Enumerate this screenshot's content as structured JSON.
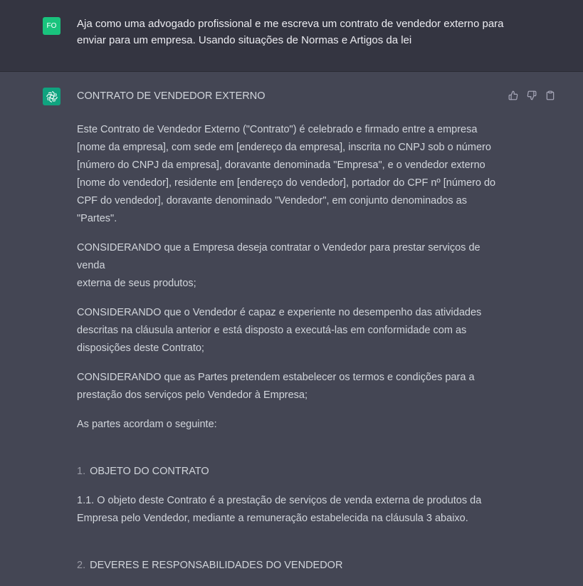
{
  "user": {
    "avatar_initials": "FO",
    "message": "Aja como uma advogado profissional e me escreva um contrato de vendedor externo para\nenviar para um empresa. Usando situações de Normas e Artigos da lei"
  },
  "assistant": {
    "icon": "openai-logo-icon",
    "actions": [
      "thumbs-up-icon",
      "thumbs-down-icon",
      "copy-icon"
    ],
    "title": "CONTRATO DE VENDEDOR EXTERNO",
    "paragraphs": [
      "Este Contrato de Vendedor Externo (\"Contrato\") é celebrado e firmado entre a empresa\n[nome da empresa], com sede em [endereço da empresa], inscrita no CNPJ sob o número\n[número do CNPJ da empresa], doravante denominada \"Empresa\", e o vendedor externo\n[nome do vendedor], residente em [endereço do vendedor], portador do CPF nº [número do\nCPF do vendedor], doravante denominado \"Vendedor\", em conjunto denominados as\n\"Partes\".",
      "CONSIDERANDO que a Empresa deseja contratar o Vendedor para prestar serviços de venda\nexterna de seus produtos;",
      "CONSIDERANDO que o Vendedor é capaz e experiente no desempenho das atividades\ndescritas na cláusula anterior e está disposto a executá-las em conformidade com as\ndisposições deste Contrato;",
      "CONSIDERANDO que as Partes pretendem estabelecer os termos e condições para a\nprestação dos serviços pelo Vendedor à Empresa;",
      "As partes acordam o seguinte:"
    ],
    "section1": {
      "number": "1.",
      "title": "OBJETO DO CONTRATO"
    },
    "clause_1_1": "1.1. O objeto deste Contrato é a prestação de serviços de venda externa de produtos da\nEmpresa pelo Vendedor, mediante a remuneração estabelecida na cláusula 3 abaixo.",
    "section2": {
      "number": "2.",
      "title": "DEVERES E RESPONSABILIDADES DO VENDEDOR"
    }
  }
}
